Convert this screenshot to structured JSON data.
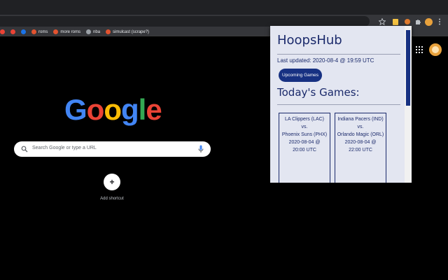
{
  "browser": {
    "star_icon": "star-icon",
    "bookmarks": [
      {
        "label": "",
        "color": "#ea4335"
      },
      {
        "label": "",
        "color": "#ea4335"
      },
      {
        "label": "",
        "color": "#1a73e8"
      },
      {
        "label": "roms",
        "color": "#e2532f"
      },
      {
        "label": "more roms",
        "color": "#e2532f"
      },
      {
        "label": "nba",
        "color": "#9aa0a6"
      },
      {
        "label": "simulcast (scrape?)",
        "color": "#e2532f"
      }
    ]
  },
  "ntp": {
    "search_placeholder": "Search Google or type a URL",
    "add_shortcut_label": "Add shortcut",
    "logo_letters": [
      "G",
      "o",
      "o",
      "g",
      "l",
      "e"
    ],
    "logo_colors": [
      "#4285f4",
      "#ea4335",
      "#fbbc05",
      "#4285f4",
      "#34a853",
      "#ea4335"
    ]
  },
  "popup": {
    "title": "HoopsHub",
    "last_updated": "Last updated: 2020-08-4 @ 19:59 UTC",
    "upcoming_button": "Upcoming Games",
    "todays_heading": "Today's Games:",
    "games": [
      {
        "home": "LA Clippers (LAC)",
        "vs": "vs.",
        "away": "Phoenix Suns (PHX)",
        "date": "2020-08-04 @",
        "time": "20:00 UTC"
      },
      {
        "home": "Indiana Pacers (IND)",
        "vs": "vs.",
        "away": "Orlando Magic (ORL)",
        "date": "2020-08-04 @",
        "time": "22:00 UTC"
      }
    ]
  },
  "colors": {
    "accent": "#173182",
    "popup_bg": "#e3e6f1",
    "game_button": "#c8102e"
  }
}
